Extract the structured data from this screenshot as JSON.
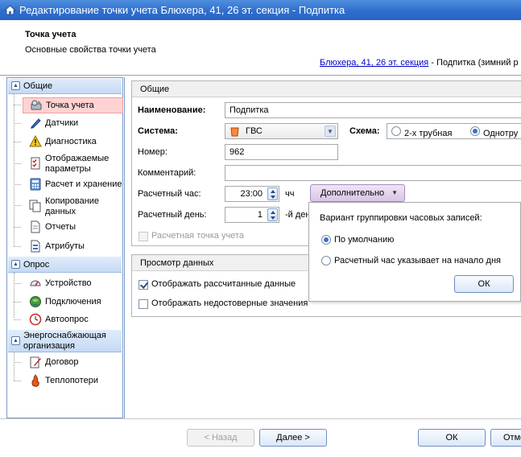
{
  "window": {
    "title": "Редактирование точки учета Блюхера, 41, 26 эт. секция - Подпитка"
  },
  "header": {
    "title": "Точка учета",
    "subtitle": "Основные свойства точки учета",
    "breadcrumb_link": "Блюхера, 41, 26 эт. секция",
    "breadcrumb_rest": " - Подпитка (зимний р"
  },
  "sidebar": {
    "groups": [
      {
        "label": "Общие",
        "items": [
          "Точка учета",
          "Датчики",
          "Диагностика",
          "Отображаемые параметры",
          "Расчет и хранение",
          "Копирование данных",
          "Отчеты",
          "Атрибуты"
        ]
      },
      {
        "label": "Опрос",
        "items": [
          "Устройство",
          "Подключения",
          "Автоопрос"
        ]
      },
      {
        "label": "Энергоснабжающая организация",
        "items": [
          "Договор",
          "Теплопотери"
        ]
      }
    ]
  },
  "general": {
    "panel_title": "Общие",
    "name_label": "Наименование:",
    "name_value": "Подпитка",
    "system_label": "Система:",
    "system_value": "ГВС",
    "scheme_label": "Схема:",
    "scheme_option1": "2-х трубная",
    "scheme_option2": "Однотру",
    "number_label": "Номер:",
    "number_value": "962",
    "comment_label": "Комментарий:",
    "comment_value": "",
    "hour_label": "Расчетный час:",
    "hour_value": "23:00",
    "hour_unit": "чч",
    "more_button": "Дополнительно",
    "day_label": "Расчетный день:",
    "day_value": "1",
    "day_unit": "-й ден",
    "calc_point_label": "Расчетная точка учета"
  },
  "view": {
    "panel_title": "Просмотр данных",
    "show_calculated": "Отображать рассчитанные данные",
    "show_unreliable": "Отображать недостоверные значения"
  },
  "popup": {
    "title": "Вариант группировки часовых записей:",
    "option_default": "По умолчанию",
    "option_start": "Расчетный час указывает на начало дня",
    "ok": "ОК"
  },
  "footer": {
    "back": "< Назад",
    "next": "Далее >",
    "ok": "ОК",
    "cancel": "Отме"
  }
}
